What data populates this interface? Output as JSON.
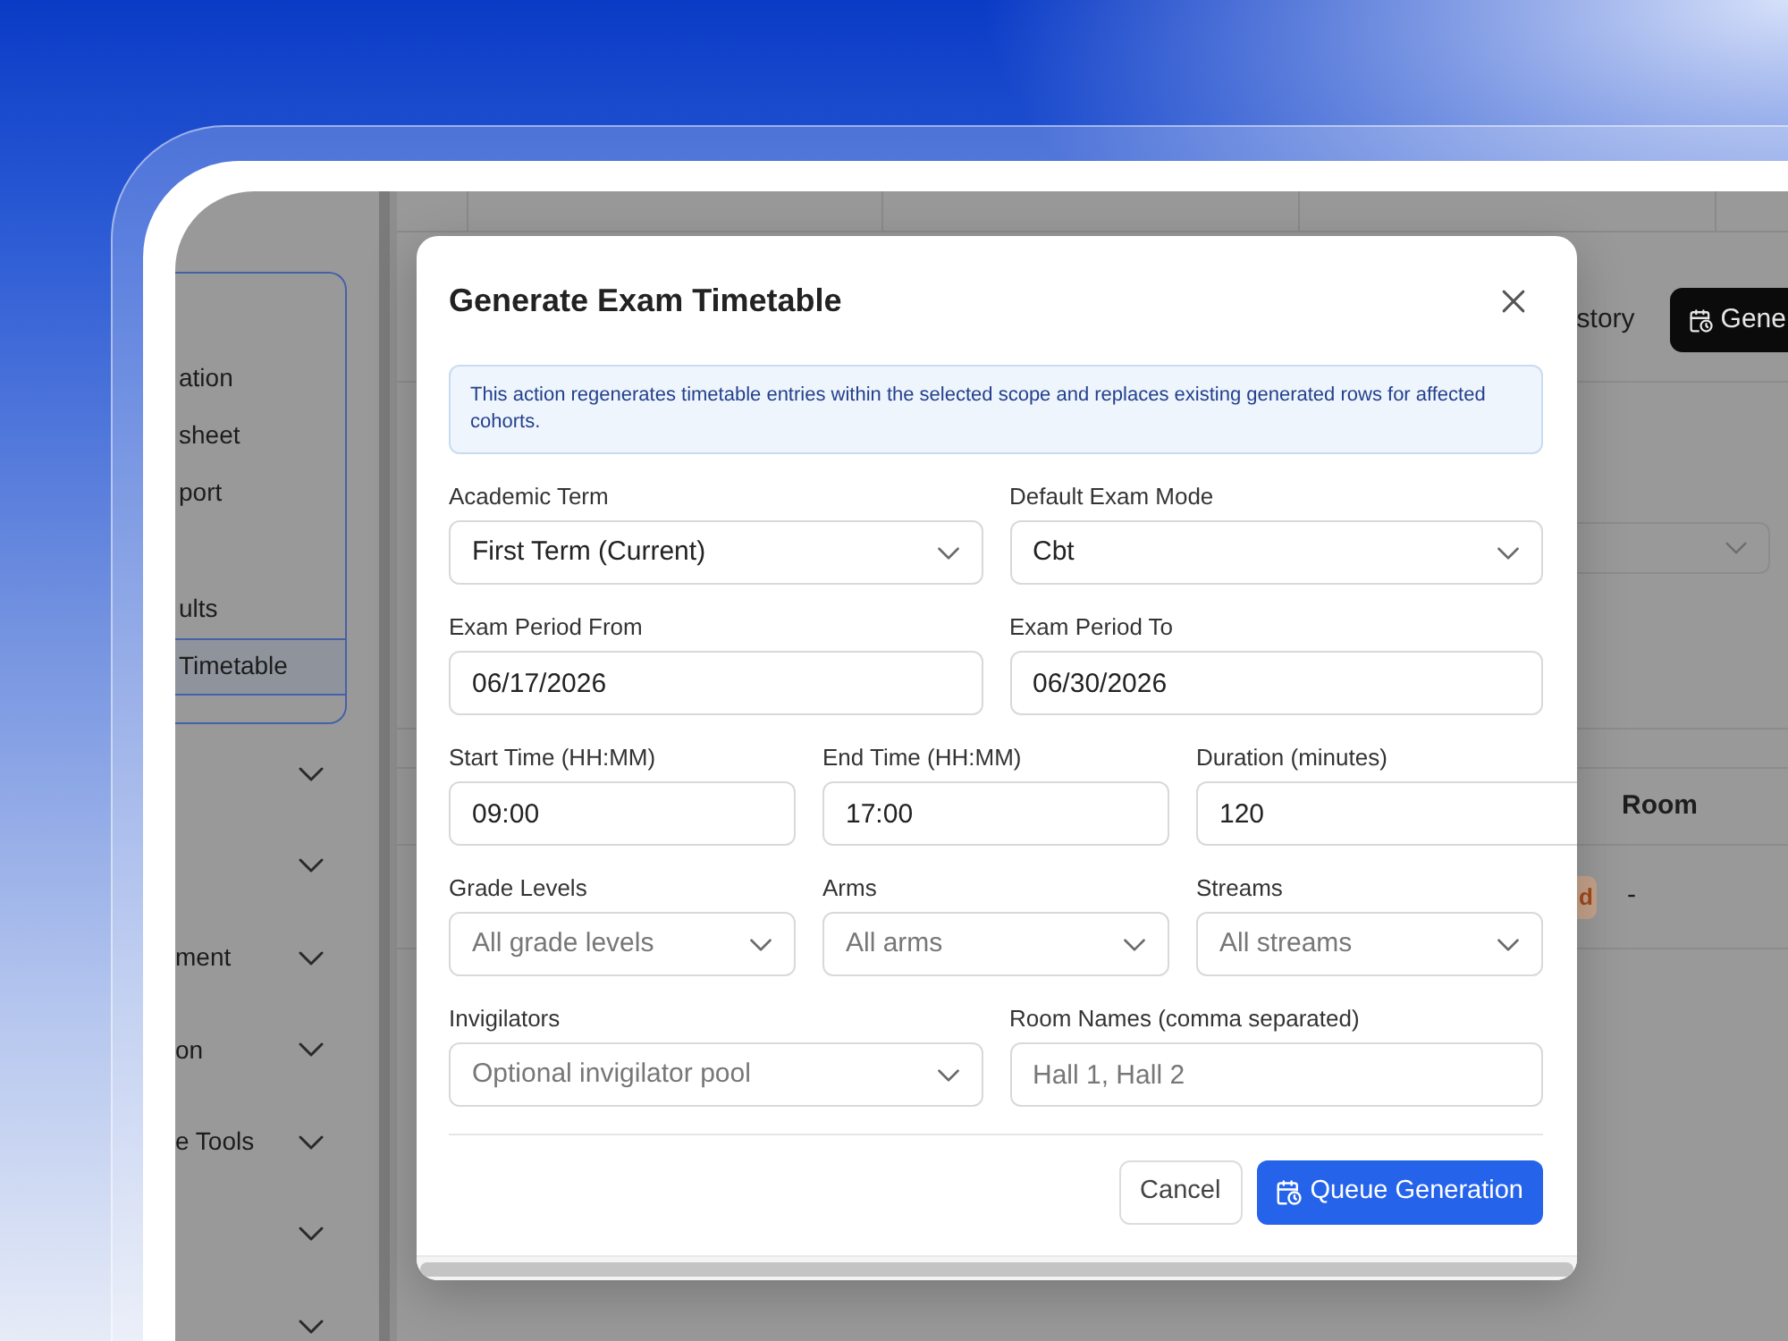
{
  "sidebar": {
    "menu_items": [
      {
        "label": "ation",
        "selected": false
      },
      {
        "label": "sheet",
        "selected": false
      },
      {
        "label": "port",
        "selected": false
      },
      {
        "label": "ults",
        "selected": false
      },
      {
        "label": "Timetable",
        "selected": true
      }
    ],
    "nav_groups": [
      {
        "expanded": false
      },
      {
        "expanded": false
      },
      {
        "label": "ment",
        "expanded": false
      },
      {
        "label": "on",
        "expanded": false
      },
      {
        "label": "e Tools",
        "expanded": false
      },
      {
        "expanded": false
      },
      {
        "expanded": false
      }
    ]
  },
  "page": {
    "toolbar": {
      "secondary_button": "story",
      "primary_button": "Gene"
    },
    "table": {
      "columns": [
        "Room"
      ],
      "rows": [
        {
          "status": "d",
          "room": "-"
        }
      ]
    }
  },
  "dialog": {
    "title": "Generate Exam Timetable",
    "notice": "This action regenerates timetable entries within the selected scope and replaces existing generated rows for affected cohorts.",
    "field_rows": [
      [
        {
          "label": "Academic Term",
          "kind": "select",
          "value": "First Term (Current)"
        },
        {
          "label": "Default Exam Mode",
          "kind": "select",
          "value": "Cbt"
        }
      ],
      [
        {
          "label": "Exam Period From",
          "kind": "input",
          "value": "06/17/2026"
        },
        {
          "label": "Exam Period To",
          "kind": "input",
          "value": "06/30/2026"
        }
      ],
      [
        {
          "label": "Start Time (HH:MM)",
          "kind": "input",
          "value": "09:00"
        },
        {
          "label": "End Time (HH:MM)",
          "kind": "input",
          "value": "17:00"
        },
        {
          "label": "Duration (minutes)",
          "kind": "input",
          "value": "120"
        }
      ],
      [
        {
          "label": "Grade Levels",
          "kind": "select",
          "placeholder": "All grade levels"
        },
        {
          "label": "Arms",
          "kind": "select",
          "placeholder": "All arms"
        },
        {
          "label": "Streams",
          "kind": "select",
          "placeholder": "All streams"
        }
      ],
      [
        {
          "label": "Invigilators",
          "kind": "select",
          "placeholder": "Optional invigilator pool"
        },
        {
          "label": "Room Names (comma separated)",
          "kind": "input",
          "placeholder": "Hall 1, Hall 2"
        }
      ]
    ],
    "buttons": [
      {
        "label": "Cancel",
        "kind": "secondary"
      },
      {
        "label": "Queue Generation",
        "kind": "primary"
      }
    ]
  }
}
